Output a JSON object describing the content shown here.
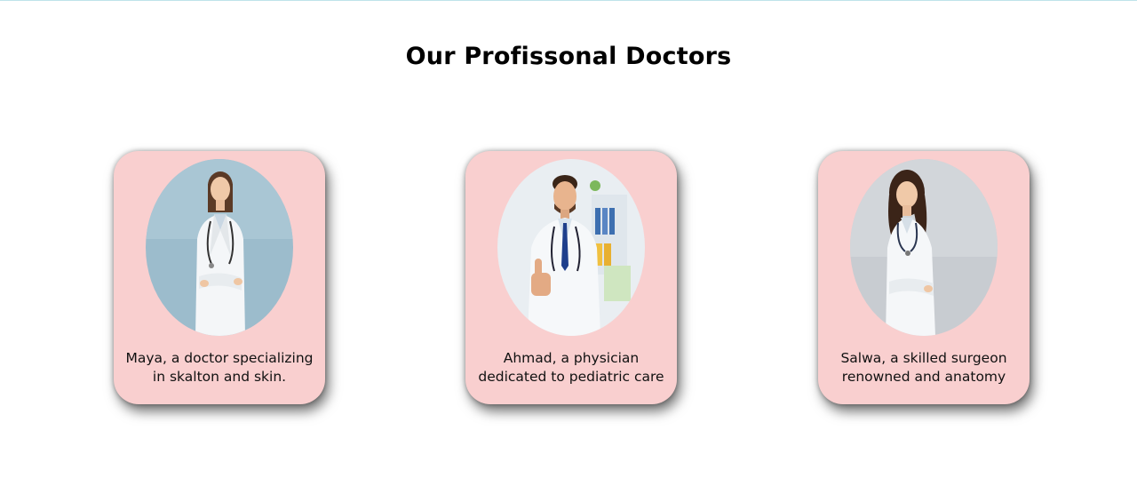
{
  "page": {
    "title": "Our Profissonal Doctors"
  },
  "doctors": [
    {
      "caption_lines": [
        "Maya, a doctor specializing",
        "in skalton and skin."
      ],
      "photo_icon": "female-doctor-portrait"
    },
    {
      "caption_lines": [
        "Ahmad, a physician",
        "dedicated to pediatric care"
      ],
      "photo_icon": "male-doctor-thumbs-up-portrait"
    },
    {
      "caption_lines": [
        "Salwa, a skilled surgeon",
        "renowned and anatomy"
      ],
      "photo_icon": "female-surgeon-portrait"
    }
  ],
  "colors": {
    "card_background": "#f9cfcf",
    "top_rule": "#bfe3ea",
    "photo1_background": "#9cbccc",
    "photo2_background": "#e9eef2",
    "photo3_background": "#c8ccd1"
  }
}
